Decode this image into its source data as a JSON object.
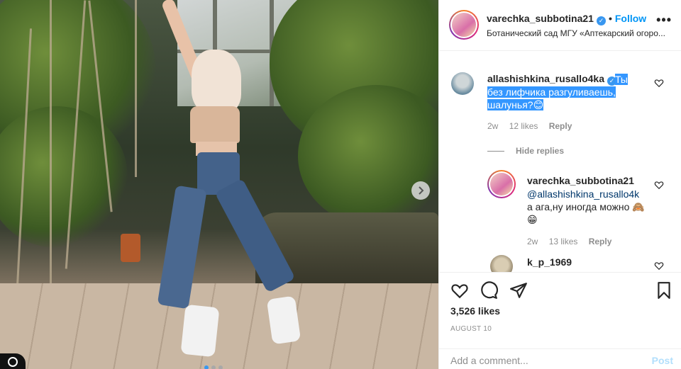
{
  "post": {
    "username": "varechka_subbotina21",
    "follow_label": "Follow",
    "separator": "•",
    "location": "Ботанический сад МГУ «Аптекарский огоро...",
    "more_label": "•••"
  },
  "comments": [
    {
      "username": "allashishkina_rusallo4ka",
      "text": "Ты без лифчика разгуливаешь, шалунья?😊",
      "age": "2w",
      "likes": "12 likes",
      "reply_label": "Reply"
    }
  ],
  "hide_replies_label": "Hide replies",
  "replies": [
    {
      "username": "varechka_subbotina21",
      "mention": "@allashishkina_rusallo4k",
      "text": "а ага,ну иногда можно 🙈😁",
      "age": "2w",
      "likes": "13 likes",
      "reply_label": "Reply"
    },
    {
      "username": "k_p_1969"
    }
  ],
  "actions": {
    "likes_count": "3,526 likes",
    "date": "AUGUST 10"
  },
  "add_comment": {
    "placeholder": "Add a comment...",
    "post_label": "Post"
  },
  "colors": {
    "accent": "#0095f6",
    "highlight": "#3396ff",
    "muted": "#8e8e8e"
  }
}
